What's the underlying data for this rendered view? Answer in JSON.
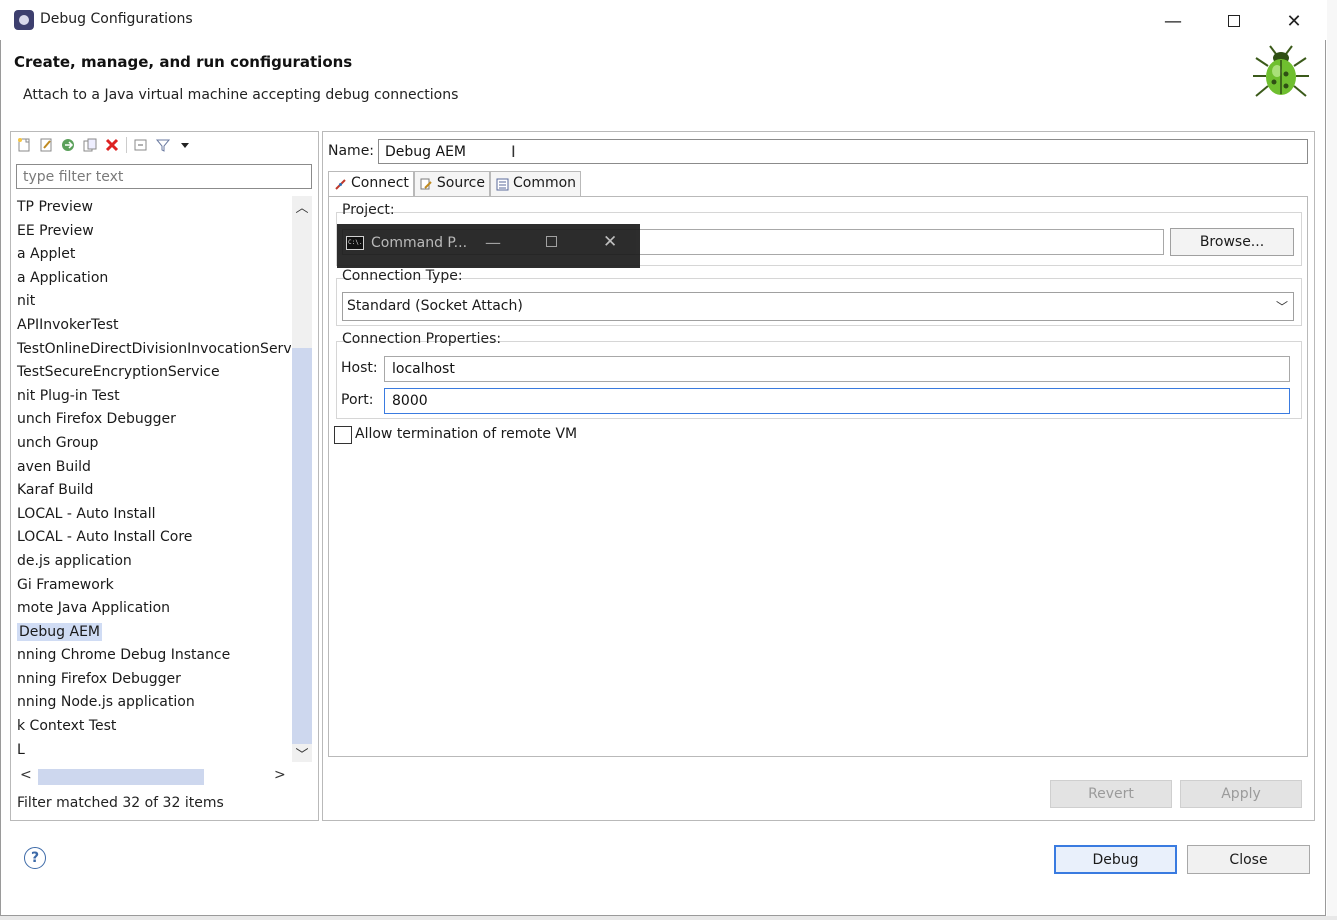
{
  "window": {
    "title": "Debug Configurations",
    "controls": {
      "minimize": "—",
      "close": "✕"
    }
  },
  "banner": {
    "title": "Create, manage, and run configurations",
    "description": "Attach to a Java virtual machine accepting debug connections"
  },
  "left": {
    "filter_placeholder": "type filter text",
    "tree_items": [
      "TP Preview",
      "EE Preview",
      "a Applet",
      "a Application",
      "nit",
      "APIInvokerTest",
      "TestOnlineDirectDivisionInvocationServic",
      "TestSecureEncryptionService",
      "nit Plug-in Test",
      "unch Firefox Debugger",
      "unch Group",
      "aven Build",
      "Karaf Build",
      "LOCAL - Auto Install",
      "LOCAL - Auto Install Core",
      "de.js application",
      "Gi Framework",
      "mote Java Application",
      "Debug AEM",
      "nning Chrome Debug Instance",
      "nning Firefox Debugger",
      "nning Node.js application",
      "k Context Test",
      "L"
    ],
    "selected_index": 18,
    "filter_status": "Filter matched 32 of 32 items"
  },
  "right": {
    "name_label": "Name:",
    "name_value": "Debug AEM",
    "tabs": [
      {
        "label": "Connect",
        "icon": "connect-icon"
      },
      {
        "label": "Source",
        "icon": "source-icon"
      },
      {
        "label": "Common",
        "icon": "common-icon"
      }
    ],
    "project_label": "Project:",
    "browse_label": "Browse...",
    "connection_type_label": "Connection Type:",
    "connection_type_value": "Standard (Socket Attach)",
    "connection_properties_label": "Connection Properties:",
    "host_label": "Host:",
    "host_value": "localhost",
    "port_label": "Port:",
    "port_value": "8000",
    "allow_termination_label": "Allow termination of remote VM",
    "allow_termination_checked": false,
    "revert_label": "Revert",
    "apply_label": "Apply"
  },
  "footer": {
    "debug_label": "Debug",
    "close_label": "Close"
  },
  "cmd_window": {
    "title": "Command P...",
    "icon_text": "C:\\."
  },
  "colors": {
    "selection": "#d0dcf4",
    "focus_border": "#3a7be0",
    "scroll_thumb": "#cdd7ee"
  }
}
